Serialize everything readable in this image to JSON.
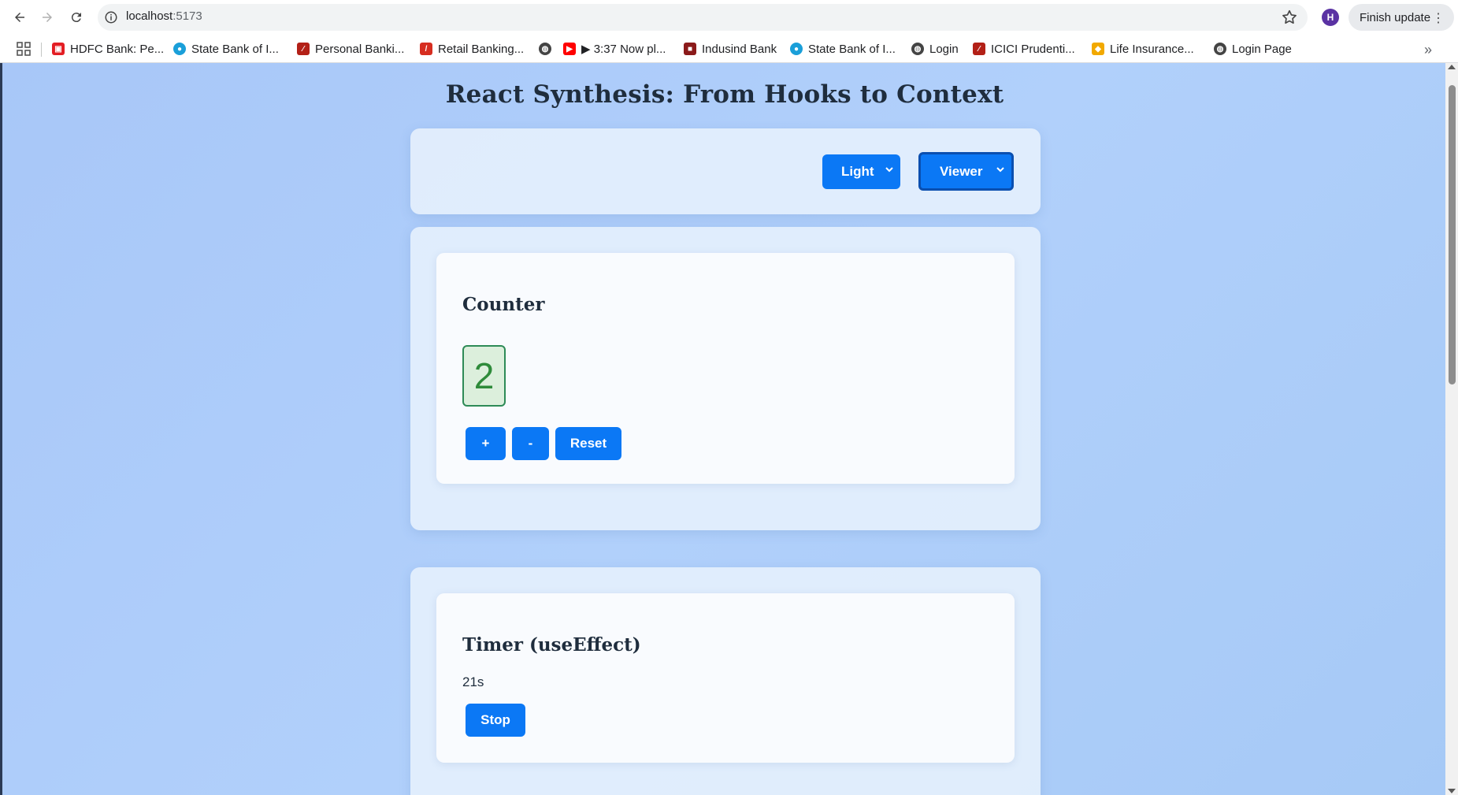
{
  "browser": {
    "url_host": "localhost",
    "url_port": ":5173",
    "avatar_letter": "H",
    "finish_update_label": "Finish update",
    "bookmarks": [
      {
        "label": "HDFC Bank: Pe...",
        "icon": "hdfc-icon",
        "color": "#e31e24"
      },
      {
        "label": "State Bank of I...",
        "icon": "sbi-icon",
        "color": "#1a9fd9"
      },
      {
        "label": "Personal Banki...",
        "icon": "icici-icon",
        "color": "#b32017"
      },
      {
        "label": "Retail Banking...",
        "icon": "slash-icon",
        "color": "#d62d20"
      },
      {
        "label": "",
        "icon": "globe-icon",
        "color": "#444444"
      },
      {
        "label": "▶ 3:37 Now pl...",
        "icon": "youtube-icon",
        "color": "#ff0000"
      },
      {
        "label": "Indusind Bank",
        "icon": "indusind-icon",
        "color": "#8b1a1a"
      },
      {
        "label": "State Bank of I...",
        "icon": "sbi-icon",
        "color": "#1a9fd9"
      },
      {
        "label": "Login",
        "icon": "globe-icon",
        "color": "#444444"
      },
      {
        "label": "ICICI Prudenti...",
        "icon": "icici-icon",
        "color": "#b32017"
      },
      {
        "label": "Life Insurance...",
        "icon": "lic-icon",
        "color": "#f2a900"
      },
      {
        "label": "Login Page",
        "icon": "globe-icon",
        "color": "#444444"
      }
    ]
  },
  "page": {
    "title": "React Synthesis: From Hooks to Context",
    "controls": {
      "theme_value": "Light",
      "role_value": "Viewer"
    },
    "counter": {
      "title": "Counter",
      "value": "2",
      "increment_label": "+",
      "decrement_label": "-",
      "reset_label": "Reset"
    },
    "timer": {
      "title": "Timer (useEffect)",
      "elapsed": "21s",
      "stop_label": "Stop"
    }
  },
  "colors": {
    "accent": "#0b78f5",
    "background": "#aecbf7",
    "counter_green": "#2e8b3a"
  }
}
